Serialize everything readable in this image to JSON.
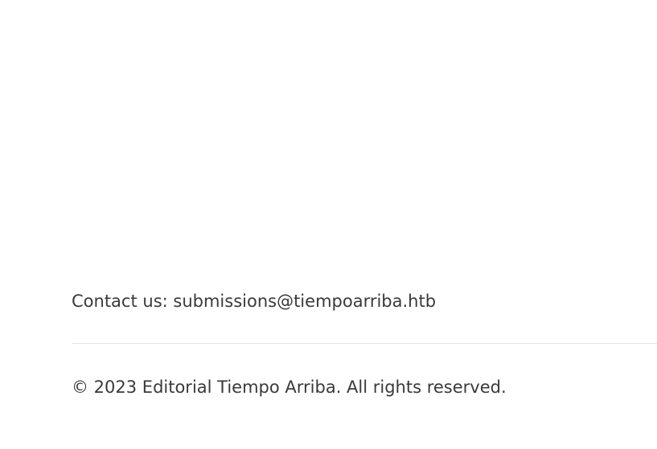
{
  "footer": {
    "contact_prefix": "Contact us: ",
    "contact_email": "submissions@tiempoarriba.htb",
    "copyright": "© 2023 Editorial Tiempo Arriba. All rights reserved."
  }
}
